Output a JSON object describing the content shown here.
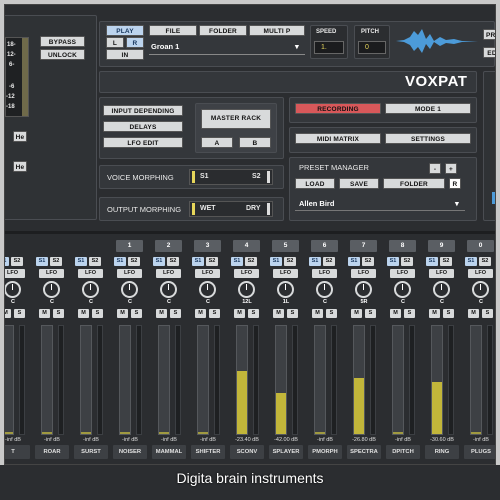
{
  "left_panel": {
    "ticks": [
      "18-",
      "12-",
      "6-",
      "-6",
      "-12",
      "-18"
    ],
    "bypass": "BYPASS",
    "unlock": "UNLOCK",
    "he1": "He",
    "he2": "He"
  },
  "transport": {
    "play": "PLAY",
    "l": "L",
    "r": "R",
    "in": "IN",
    "file": "FILE",
    "folder": "FOLDER",
    "multi": "MULTI P",
    "file_value": "Groan 1",
    "speed_label": "SPEED",
    "speed_value": "1.",
    "pitch_label": "PITCH",
    "pitch_value": "0",
    "pre": "PRE",
    "edi": "EDI"
  },
  "title": "VOXPAT",
  "routing": {
    "input": "INPUT DEPENDING",
    "delays": "DELAYS",
    "lfo_edit": "LFO EDIT",
    "master": "MASTER RACK",
    "a": "A",
    "b": "B"
  },
  "record": {
    "recording": "RECORDING",
    "mode": "MODE 1",
    "midi": "MIDI MATRIX",
    "settings": "SETTINGS"
  },
  "morph": {
    "voice": "VOICE MORPHING",
    "s1": "S1",
    "s2": "S2",
    "output": "OUTPUT MORPHING",
    "wet": "WET",
    "dry": "DRY"
  },
  "preset": {
    "title": "PRESET MANAGER",
    "minus": "-",
    "plus": "+",
    "load": "LOAD",
    "save": "SAVE",
    "folder": "FOLDER",
    "r": "R",
    "value": "Allen Bird"
  },
  "strip_common": {
    "s1": "S1",
    "s2": "S2",
    "lfo": "LFO",
    "m": "M",
    "s": "S"
  },
  "strips": [
    {
      "num": "",
      "knob": "C",
      "db": "-inf dB",
      "name": "T",
      "level": 0
    },
    {
      "num": "",
      "knob": "C",
      "db": "-inf dB",
      "name": "ROAR",
      "level": 0
    },
    {
      "num": "",
      "knob": "C",
      "db": "-inf dB",
      "name": "SURST",
      "level": 0
    },
    {
      "num": "1",
      "knob": "C",
      "db": "-inf dB",
      "name": "NOISER",
      "level": 0
    },
    {
      "num": "2",
      "knob": "C",
      "db": "-inf dB",
      "name": "MAMMAL",
      "level": 0
    },
    {
      "num": "3",
      "knob": "C",
      "db": "-inf dB",
      "name": "SHIFTER",
      "level": 0
    },
    {
      "num": "4",
      "knob": "12L",
      "db": "-23.40 dB",
      "name": "SCONV",
      "level": 0.58
    },
    {
      "num": "5",
      "knob": "1L",
      "db": "-42.00 dB",
      "name": "SPLAYER",
      "level": 0.38
    },
    {
      "num": "6",
      "knob": "C",
      "db": "-inf dB",
      "name": "PMORPH",
      "level": 0
    },
    {
      "num": "7",
      "knob": "5R",
      "db": "-26.80 dB",
      "name": "SPECTRA",
      "level": 0.52
    },
    {
      "num": "8",
      "knob": "C",
      "db": "-inf dB",
      "name": "DPITCH",
      "level": 0
    },
    {
      "num": "9",
      "knob": "C",
      "db": "-30.60 dB",
      "name": "RING",
      "level": 0.48
    },
    {
      "num": "0",
      "knob": "C",
      "db": "-inf dB",
      "name": "PLUGS",
      "level": 0
    }
  ],
  "caption": "Digita brain instruments"
}
